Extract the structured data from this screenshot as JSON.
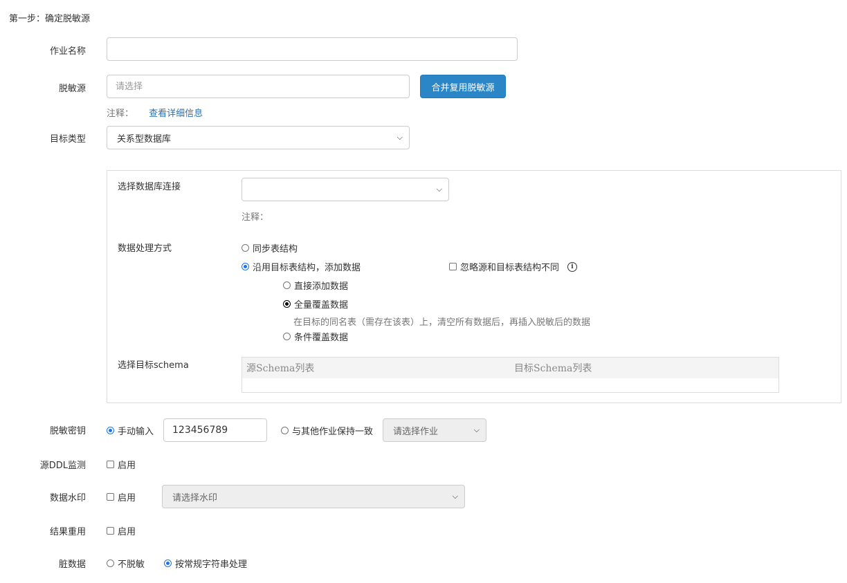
{
  "step_title": "第一步：确定脱敏源",
  "job_name": {
    "label": "作业名称",
    "value": ""
  },
  "source": {
    "label": "脱敏源",
    "placeholder": "请选择",
    "merge_button": "合并复用脱敏源",
    "note_label": "注释：",
    "detail_link": "查看详细信息"
  },
  "target_type": {
    "label": "目标类型",
    "value": "关系型数据库"
  },
  "panel": {
    "db_conn": {
      "label": "选择数据库连接",
      "value": "",
      "note_label": "注释："
    },
    "processing": {
      "label": "数据处理方式",
      "sync_structure": "同步表结构",
      "use_target_structure": "沿用目标表结构，添加数据",
      "ignore_diff": "忽略源和目标表结构不同",
      "direct_add": "直接添加数据",
      "full_overwrite": "全量覆盖数据",
      "full_overwrite_desc": "在目标的同名表（需存在该表）上，清空所有数据后，再插入脱敏后的数据",
      "conditional_overwrite": "条件覆盖数据"
    },
    "schema": {
      "label": "选择目标schema",
      "source_col": "源Schema列表",
      "target_col": "目标Schema列表"
    }
  },
  "mask_key": {
    "label": "脱敏密钥",
    "manual": "手动输入",
    "manual_value": "123456789",
    "same_as_other": "与其他作业保持一致",
    "job_select": "请选择作业"
  },
  "ddl_monitor": {
    "label": "源DDL监测",
    "enable": "启用"
  },
  "watermark": {
    "label": "数据水印",
    "enable": "启用",
    "select": "请选择水印"
  },
  "result_reuse": {
    "label": "结果重用",
    "enable": "启用"
  },
  "dirty_data": {
    "label": "脏数据",
    "no_mask": "不脱敏",
    "as_string": "按常规字符串处理"
  },
  "colors": {
    "primary": "#2b86c8",
    "link": "#2b6fae",
    "radio_checked": "#1a73e8"
  }
}
